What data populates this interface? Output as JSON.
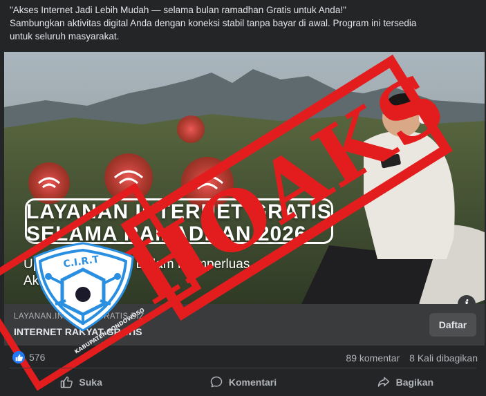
{
  "post": {
    "caption_line1": "\"Akses Internet Jadi Lebih Mudah — selama bulan ramadhan Gratis untuk Anda!\"",
    "caption_line2": "Sambungkan aktivitas digital Anda dengan koneksi stabil tanpa bayar di awal. Program ini tersedia",
    "caption_line3": "untuk seluruh masyarakat."
  },
  "ad_image": {
    "headline_line1": "LAYANAN INTERNET GRATIS",
    "headline_line2": "SELAMA RAMADHAN 2026",
    "subline1": "Upaya Pemerintah Dalam Memperluas",
    "subline2": "Akses di Daerah"
  },
  "link_preview": {
    "url": "LAYANAN.INTERNETGRATIS.BIZ",
    "title": "INTERNET RAKYAT GRATIS",
    "cta_label": "Daftar",
    "info_label": "i"
  },
  "stamp": {
    "hoax_text": "HOAKS",
    "badge_title": "C.I.R.T",
    "badge_subtitle": "KABUPATEN BONDOWOSO",
    "stamp_color": "#e31d1d",
    "badge_color": "#2a8fe0"
  },
  "engagement": {
    "like_count": "576",
    "comments": "89 komentar",
    "shares": "8 Kali dibagikan"
  },
  "actions": {
    "like": "Suka",
    "comment": "Komentari",
    "share": "Bagikan"
  }
}
